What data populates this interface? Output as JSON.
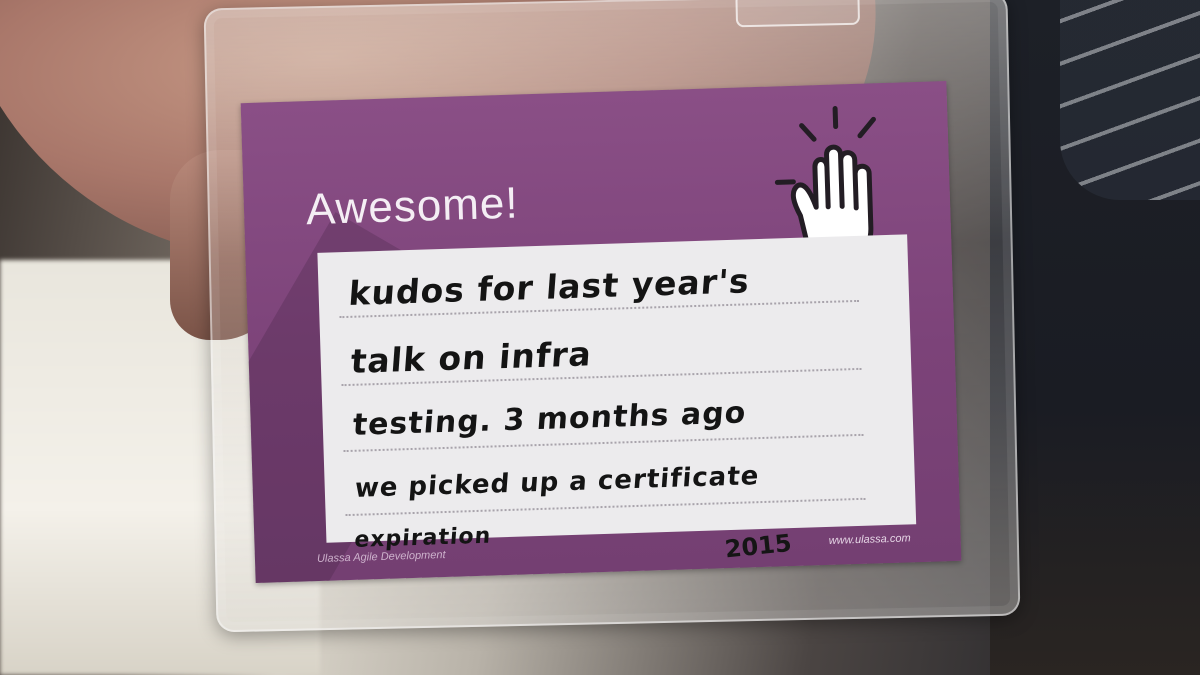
{
  "scene": {
    "description_color_card": "#7c4379",
    "description_color_note": "#ecebed"
  },
  "card": {
    "title": "Awesome!",
    "handwriting": {
      "line1": "kudos for last year's",
      "line2": "talk on infra",
      "line3": "testing. 3 months ago",
      "line4": "we picked up a certificate",
      "line5": "expiration",
      "year": "2015"
    },
    "footer_left": "Ulassa Agile Development",
    "footer_right": "www.ulassa.com",
    "icon": "raised-hand-icon"
  }
}
